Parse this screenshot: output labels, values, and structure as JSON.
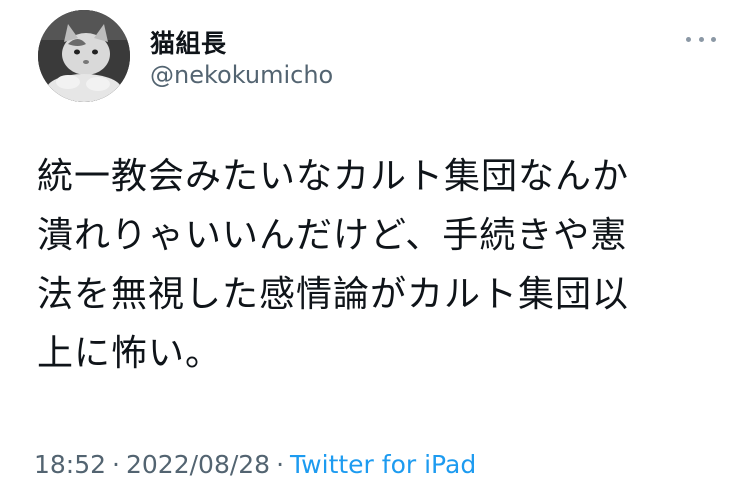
{
  "user": {
    "display_name": "猫組長",
    "handle": "@nekokumicho",
    "avatar_icon": "cat-avatar"
  },
  "tweet": {
    "lines": [
      "統一教会みたいなカルト集団なんか",
      "潰れりゃいいんだけど、手続きや憲",
      "法を無視した感情論がカルト集団以",
      "上に怖い。"
    ]
  },
  "meta": {
    "time": "18:52",
    "date": "2022/08/28",
    "separator": "·",
    "source": "Twitter for iPad"
  },
  "colors": {
    "text": "#0f1419",
    "secondary": "#536471",
    "link": "#1d9bf0"
  }
}
